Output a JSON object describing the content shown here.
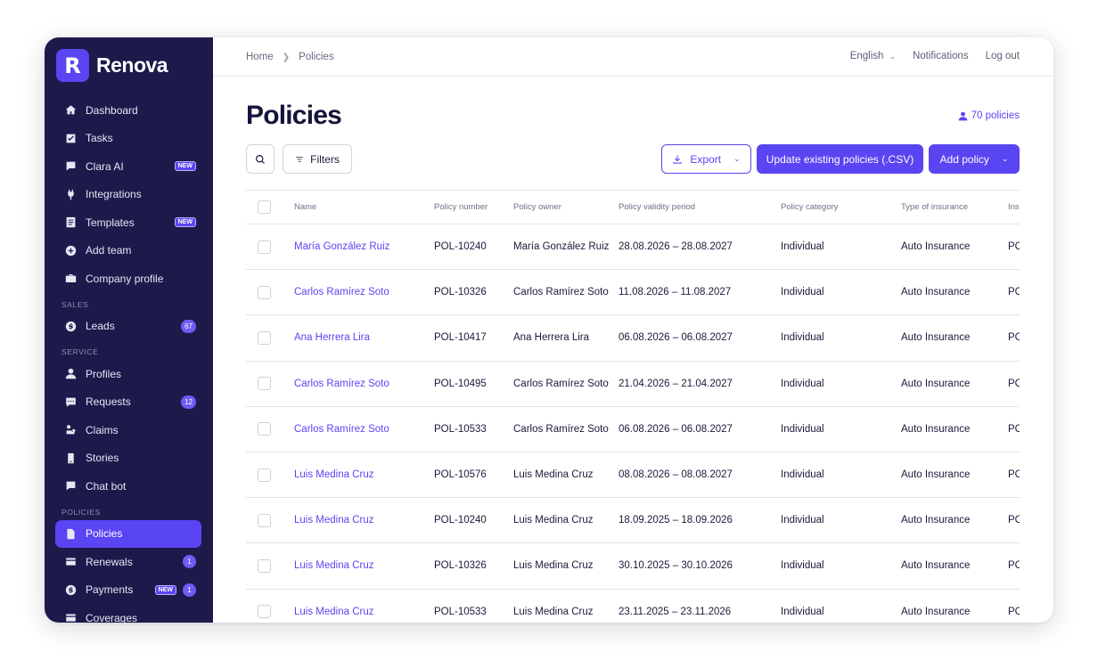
{
  "brand": {
    "logo_letter": "R",
    "name": "Renova",
    "accent": "#5a45f2",
    "sidebar_bg": "#1c1a4b"
  },
  "sidebar": {
    "items_top": [
      {
        "label": "Dashboard",
        "icon": "home-icon"
      },
      {
        "label": "Tasks",
        "icon": "checkbox-icon"
      },
      {
        "label": "Clara AI",
        "icon": "chat-icon",
        "badge": "NEW"
      },
      {
        "label": "Integrations",
        "icon": "plug-icon"
      },
      {
        "label": "Templates",
        "icon": "document-icon",
        "badge": "NEW"
      },
      {
        "label": "Add team",
        "icon": "plus-circle-icon"
      },
      {
        "label": "Company profile",
        "icon": "briefcase-icon"
      }
    ],
    "section_sales": "SALES",
    "items_sales": [
      {
        "label": "Leads",
        "icon": "dollar-icon",
        "count": "67"
      }
    ],
    "section_service": "SERVICE",
    "items_service": [
      {
        "label": "Profiles",
        "icon": "user-icon"
      },
      {
        "label": "Requests",
        "icon": "message-icon",
        "count": "12"
      },
      {
        "label": "Claims",
        "icon": "car-icon"
      },
      {
        "label": "Stories",
        "icon": "phone-icon"
      },
      {
        "label": "Chat bot",
        "icon": "chat-bubble-icon"
      }
    ],
    "section_policies": "POLICIES",
    "items_policies": [
      {
        "label": "Policies",
        "icon": "file-icon",
        "active": true
      },
      {
        "label": "Renewals",
        "icon": "wallet-icon",
        "count": "1"
      },
      {
        "label": "Payments",
        "icon": "dollar-icon",
        "badge": "NEW",
        "count": "1"
      },
      {
        "label": "Coverages",
        "icon": "wallet-icon"
      }
    ]
  },
  "topbar": {
    "breadcrumb": [
      "Home",
      "Policies"
    ],
    "language": "English",
    "notifications": "Notifications",
    "logout": "Log out"
  },
  "page": {
    "title": "Policies",
    "count_label": "70 policies"
  },
  "toolbar": {
    "filters": "Filters",
    "export": "Export",
    "update_csv": "Update existing policies (.CSV)",
    "add_policy": "Add policy"
  },
  "table": {
    "columns": [
      "Name",
      "Policy number",
      "Policy owner",
      "Policy validity period",
      "Policy category",
      "Type of insurance",
      "Ins"
    ],
    "rows": [
      {
        "name": "María González Ruiz",
        "number": "POL-10240",
        "owner": "María González Ruiz",
        "validity": "28.08.2026 – 28.08.2027",
        "category": "Individual",
        "type": "Auto Insurance",
        "ins": "PC"
      },
      {
        "name": "Carlos Ramírez Soto",
        "number": "POL-10326",
        "owner": "Carlos Ramírez Soto",
        "validity": "11.08.2026 – 11.08.2027",
        "category": "Individual",
        "type": "Auto Insurance",
        "ins": "PC"
      },
      {
        "name": "Ana Herrera Lira",
        "number": "POL-10417",
        "owner": "Ana Herrera Lira",
        "validity": "06.08.2026 – 06.08.2027",
        "category": "Individual",
        "type": "Auto Insurance",
        "ins": "PC"
      },
      {
        "name": "Carlos Ramírez Soto",
        "number": "POL-10495",
        "owner": "Carlos Ramírez Soto",
        "validity": "21.04.2026 – 21.04.2027",
        "category": "Individual",
        "type": "Auto Insurance",
        "ins": "PC"
      },
      {
        "name": "Carlos Ramírez Soto",
        "number": "POL-10533",
        "owner": "Carlos Ramírez Soto",
        "validity": "06.08.2026 – 06.08.2027",
        "category": "Individual",
        "type": "Auto Insurance",
        "ins": "PC"
      },
      {
        "name": "Luis Medina Cruz",
        "number": "POL-10576",
        "owner": "Luis Medina Cruz",
        "validity": "08.08.2026 – 08.08.2027",
        "category": "Individual",
        "type": "Auto Insurance",
        "ins": "PC"
      },
      {
        "name": "Luis Medina Cruz",
        "number": "POL-10240",
        "owner": "Luis Medina Cruz",
        "validity": "18.09.2025 – 18.09.2026",
        "category": "Individual",
        "type": "Auto Insurance",
        "ins": "PC"
      },
      {
        "name": "Luis Medina Cruz",
        "number": "POL-10326",
        "owner": "Luis Medina Cruz",
        "validity": "30.10.2025 – 30.10.2026",
        "category": "Individual",
        "type": "Auto Insurance",
        "ins": "PC"
      },
      {
        "name": "Luis Medina Cruz",
        "number": "POL-10533",
        "owner": "Luis Medina Cruz",
        "validity": "23.11.2025 – 23.11.2026",
        "category": "Individual",
        "type": "Auto Insurance",
        "ins": "PC"
      }
    ]
  }
}
